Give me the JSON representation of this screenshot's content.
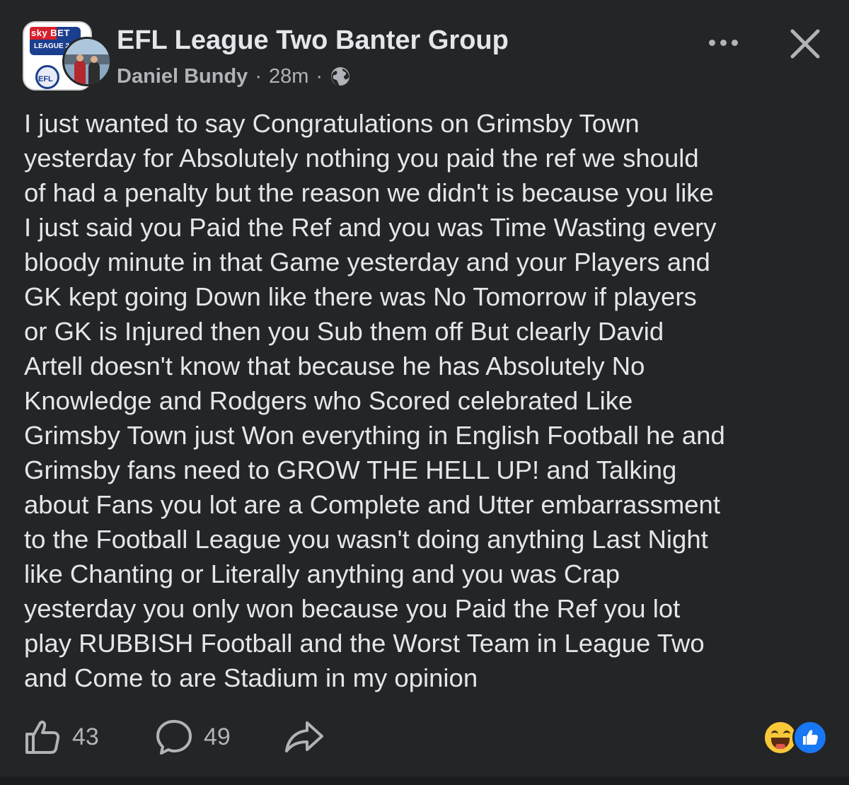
{
  "header": {
    "group_name": "EFL League Two Banter Group",
    "author": "Daniel Bundy",
    "separator": "·",
    "time": "28m",
    "audience_icon": "globe-icon",
    "group_avatar": {
      "logo_text": "sky BET",
      "league_text": "LEAGUE 2",
      "badge_text": "EFL"
    },
    "more_icon": "more-dots-icon",
    "close_icon": "close-icon"
  },
  "post": {
    "text": "I just wanted to say Congratulations on Grimsby Town\nyesterday for Absolutely nothing you paid the ref we should\nof had a penalty but the reason we didn't is because you like\nI just said you Paid the Ref and you was Time Wasting every\nbloody minute in that Game yesterday and your Players and\nGK kept going Down like there was No Tomorrow if players\nor GK is Injured then you Sub them off But clearly David\nArtell doesn't know that because he has Absolutely No\nKnowledge and Rodgers who Scored celebrated Like\nGrimsby Town just Won everything in English Football he and\nGrimsby fans need to GROW THE HELL UP! and Talking\nabout Fans you lot are a Complete and Utter embarrassment\nto the Football League you wasn't doing anything Last Night\nlike Chanting or Literally anything and you was Crap\nyesterday you only won because you Paid the Ref you lot\nplay RUBBISH Football and the Worst Team in League Two\nand Come to are Stadium in my opinion"
  },
  "actions": {
    "like_count": "43",
    "comment_count": "49",
    "like_icon": "thumbs-up-icon",
    "comment_icon": "comment-bubble-icon",
    "share_icon": "share-arrow-icon"
  },
  "reactions": {
    "items": [
      "haha-reaction-icon",
      "like-reaction-icon"
    ]
  },
  "colors": {
    "background": "#242526",
    "primary_text": "#e4e6eb",
    "secondary_text": "#b0b3b8",
    "like_blue": "#1877f2",
    "haha_yellow": "#f7c83a"
  }
}
